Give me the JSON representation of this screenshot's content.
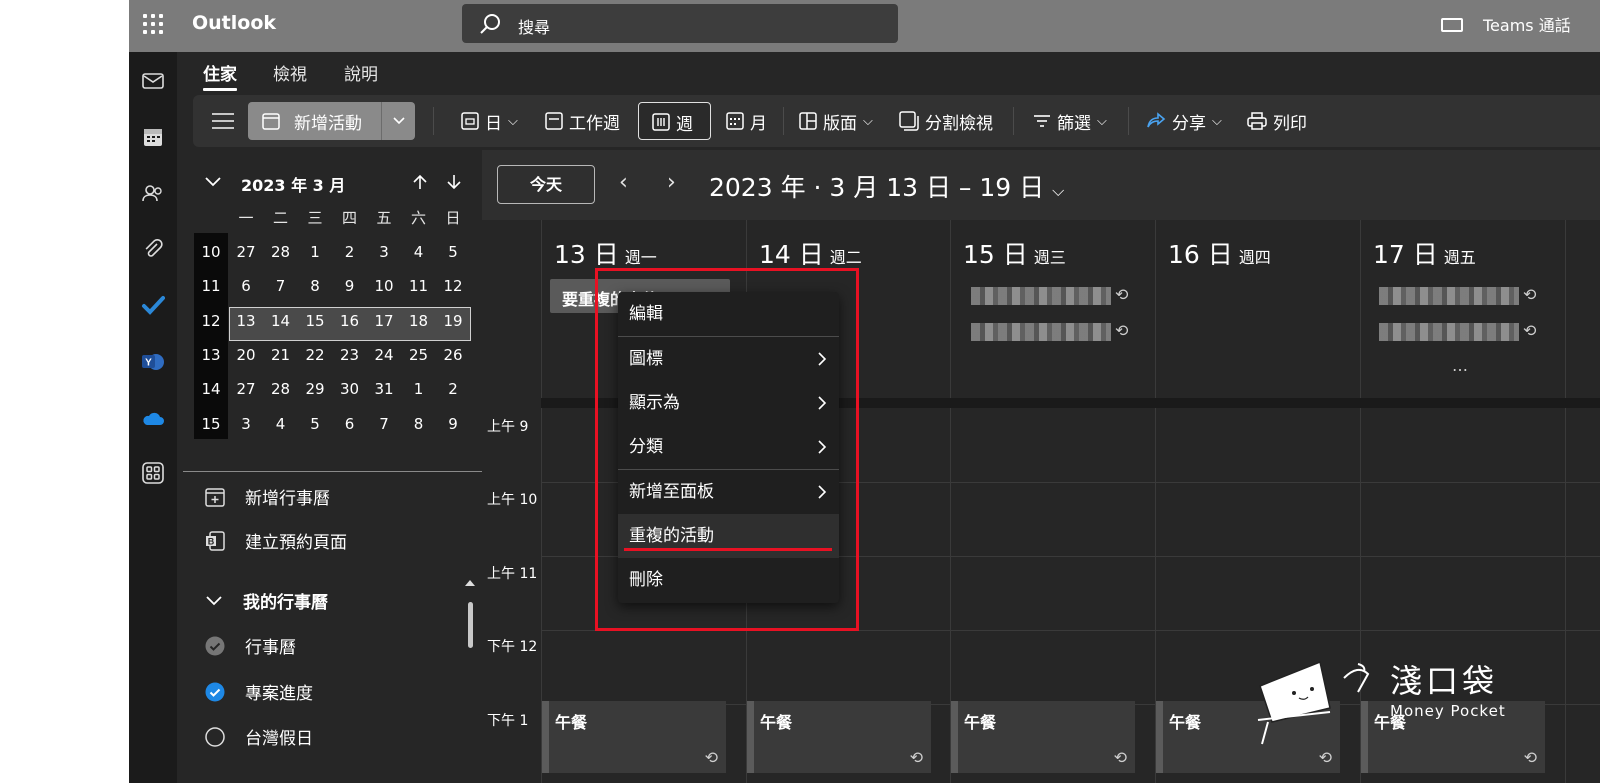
{
  "topbar": {
    "app_name": "Outlook",
    "search_placeholder": "搜尋",
    "teams_label": "Teams 通話"
  },
  "ribbon_tabs": [
    {
      "label": "住家",
      "active": true
    },
    {
      "label": "檢視",
      "active": false
    },
    {
      "label": "說明",
      "active": false
    }
  ],
  "toolbar": {
    "new_event": "新增活動",
    "day": "日",
    "work_week": "工作週",
    "week": "週",
    "month": "月",
    "layout": "版面",
    "split_view": "分割檢視",
    "filter": "篩選",
    "share": "分享",
    "print": "列印"
  },
  "mini_calendar": {
    "title": "2023 年 3 月",
    "weekdays": [
      "一",
      "二",
      "三",
      "四",
      "五",
      "六",
      "日"
    ],
    "weeks": [
      {
        "week": "10",
        "days": [
          "27",
          "28",
          "1",
          "2",
          "3",
          "4",
          "5"
        ]
      },
      {
        "week": "11",
        "days": [
          "6",
          "7",
          "8",
          "9",
          "10",
          "11",
          "12"
        ]
      },
      {
        "week": "12",
        "days": [
          "13",
          "14",
          "15",
          "16",
          "17",
          "18",
          "19"
        ]
      },
      {
        "week": "13",
        "days": [
          "20",
          "21",
          "22",
          "23",
          "24",
          "25",
          "26"
        ]
      },
      {
        "week": "14",
        "days": [
          "27",
          "28",
          "29",
          "30",
          "31",
          "1",
          "2"
        ]
      },
      {
        "week": "15",
        "days": [
          "3",
          "4",
          "5",
          "6",
          "7",
          "8",
          "9"
        ]
      }
    ],
    "selected_week_index": 2
  },
  "left_actions": {
    "add_calendar": "新增行事曆",
    "booking_page": "建立預約頁面"
  },
  "my_calendars": {
    "header": "我的行事曆",
    "items": [
      {
        "label": "行事曆",
        "state": "checked-gray"
      },
      {
        "label": "專案進度",
        "state": "checked-blue"
      },
      {
        "label": "台灣假日",
        "state": "unchecked"
      }
    ]
  },
  "calendar": {
    "today_button": "今天",
    "range_title": "2023 年 · 3 月 13 日 – 19 日",
    "days": [
      {
        "num": "13 日",
        "weekday": "週一"
      },
      {
        "num": "14 日",
        "weekday": "週二"
      },
      {
        "num": "15 日",
        "weekday": "週三"
      },
      {
        "num": "16 日",
        "weekday": "週四"
      },
      {
        "num": "17 日",
        "weekday": "週五"
      }
    ],
    "time_labels": [
      "上午 9",
      "上午 10",
      "上午 11",
      "下午 12",
      "下午 1"
    ],
    "allday_event": "要重複的事件",
    "lunch_label": "午餐",
    "more_indicator": "…"
  },
  "context_menu": {
    "items": [
      {
        "label": "編輯",
        "submenu": false
      },
      {
        "label": "圖標",
        "submenu": true
      },
      {
        "label": "顯示為",
        "submenu": true
      },
      {
        "label": "分類",
        "submenu": true
      },
      {
        "label": "新增至面板",
        "submenu": true
      },
      {
        "label": "重複的活動",
        "submenu": false
      },
      {
        "label": "刪除",
        "submenu": false
      }
    ]
  },
  "watermark": {
    "title": "淺口袋",
    "subtitle": "Money Pocket"
  },
  "colors": {
    "accent_blue": "#1e88e5",
    "highlight_red": "#e81123",
    "topbar": "#7b7b7b"
  }
}
